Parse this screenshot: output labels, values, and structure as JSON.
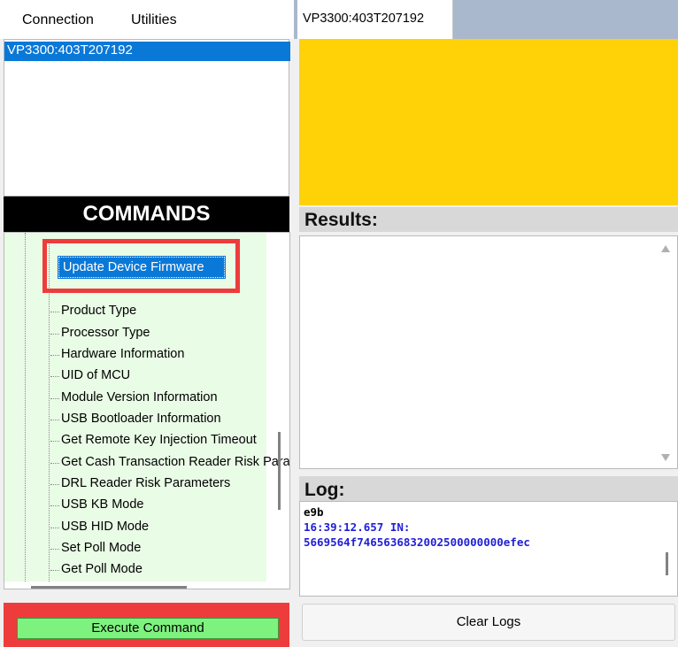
{
  "menubar": {
    "items": [
      "Connection",
      "Utilities"
    ]
  },
  "device_list": {
    "selected": "VP3300:403T207192"
  },
  "commands": {
    "header": "COMMANDS",
    "highlighted_item": "Update Device Firmware",
    "items": [
      "Product Type",
      "Processor Type",
      "Hardware Information",
      "UID of MCU",
      "Module Version Information",
      "USB Bootloader Information",
      "Get Remote Key Injection Timeout",
      "Get Cash Transaction Reader Risk Parameters",
      "DRL Reader Risk Parameters",
      "USB KB Mode",
      "USB HID Mode",
      "Set Poll Mode",
      "Get Poll Mode"
    ],
    "execute_label": "Execute Command"
  },
  "tabs": {
    "active": "VP3300:403T207192"
  },
  "status": {
    "color": "#fed206"
  },
  "results": {
    "header": "Results:",
    "text": ""
  },
  "log": {
    "header": "Log:",
    "lines": [
      {
        "text": "e9b",
        "color": "#000000"
      },
      {
        "text": "16:39:12.657  IN:",
        "color": "#1f1fd6"
      },
      {
        "text": "5669564f7465636832002500000000efec",
        "color": "#1f1fd6"
      }
    ]
  },
  "clear_logs_label": "Clear Logs",
  "colors": {
    "highlight_red": "#ee3c3c",
    "execute_green": "#7ef27e",
    "selection_blue": "#0a78d7"
  }
}
